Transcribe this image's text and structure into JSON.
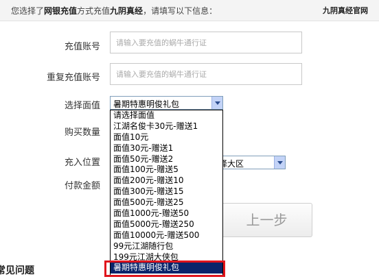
{
  "header": {
    "intro_prefix": "您选择了",
    "method": "网银充值",
    "intro_mid": "方式充值",
    "game": "九阴真经",
    "intro_suffix": "，请填写以下信息：",
    "site_link": "九阴真经官网"
  },
  "form": {
    "account_label": "充值账号",
    "account_placeholder": "请输入要充值的蜗牛通行证",
    "confirm_label": "重复充值账号",
    "confirm_placeholder": "请输入要充值的蜗牛通行证",
    "denomination_label": "选择面值",
    "denomination_value": "暑期特惠明俊礼包",
    "quantity_label": "购买数量",
    "location_label": "充入位置",
    "region_partial_text": "择大区",
    "amount_label": "付款金额",
    "prev_button": "上一步"
  },
  "dropdown": {
    "options": [
      "请选择面值",
      "江湖名俊卡30元-赠送1",
      "面值10元",
      "面值30元-赠送1",
      "面值50元-赠送2",
      "面值100元-赠送5",
      "面值200元-赠送10",
      "面值300元-赠送15",
      "面值500元-赠送25",
      "面值1000元-赠送50",
      "面值5000元-赠送250",
      "面值10000元-赠送500",
      "99元江湖随行包",
      "199元江湖大侠包",
      "暑期特惠明俊礼包"
    ],
    "selected_index": 14,
    "highlight_color": "#e0141c"
  },
  "footer": {
    "faq_partial": "常见问题"
  }
}
